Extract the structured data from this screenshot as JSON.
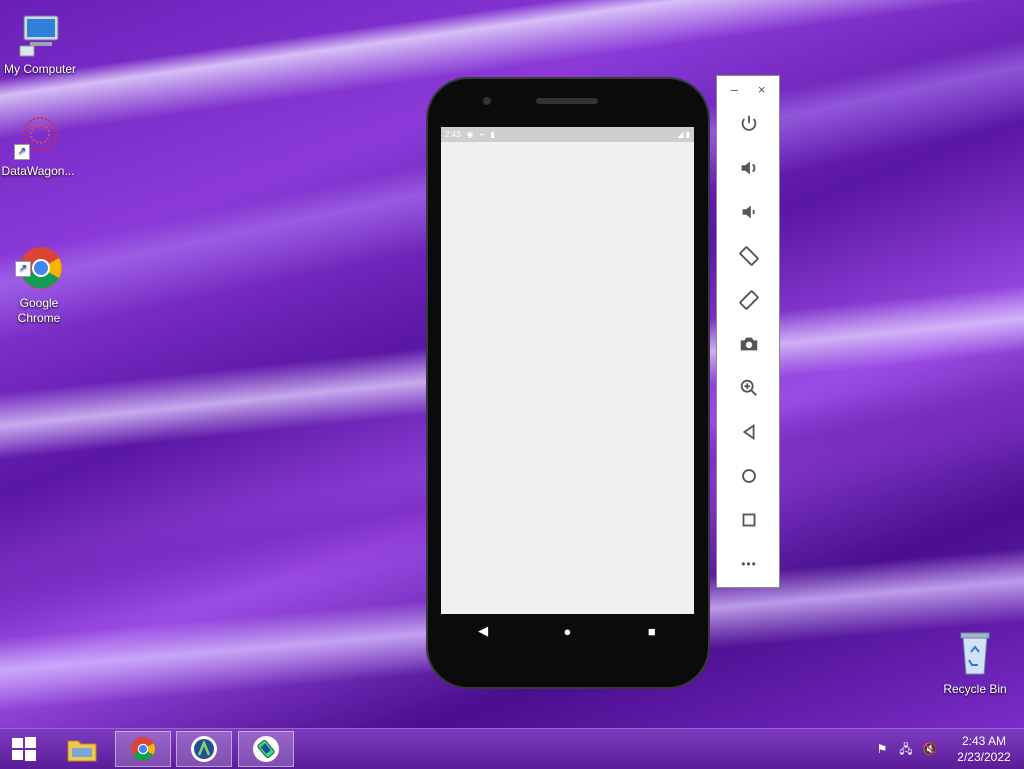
{
  "desktop": {
    "icons": [
      {
        "label": "My Computer"
      },
      {
        "label": "DataWagon..."
      },
      {
        "label": "Google\nChrome"
      },
      {
        "label": "Recycle Bin"
      }
    ]
  },
  "phone": {
    "status_time": "2:43"
  },
  "emulator_toolbar": {
    "minimize": "–",
    "close": "×",
    "more": "•••"
  },
  "taskbar": {
    "clock_time": "2:43 AM",
    "clock_date": "2/23/2022"
  },
  "colors": {
    "taskbar": "#6a2ab0",
    "screen": "#f0f0f0",
    "toolbar_icon": "#555555"
  }
}
